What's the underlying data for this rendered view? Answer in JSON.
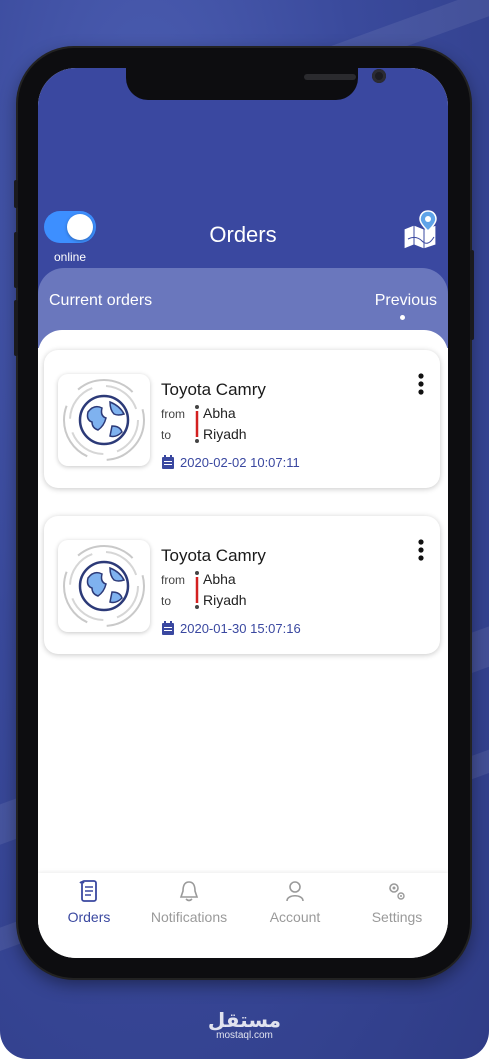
{
  "header": {
    "title": "Orders",
    "status_label": "online"
  },
  "tabs": {
    "current": "Current orders",
    "previous": "Previous"
  },
  "orders": [
    {
      "car": "Toyota Camry",
      "from_label": "from",
      "from": "Abha",
      "to_label": "to",
      "to": "Riyadh",
      "date": "2020-02-02 10:07:11"
    },
    {
      "car": "Toyota Camry",
      "from_label": "from",
      "from": "Abha",
      "to_label": "to",
      "to": "Riyadh",
      "date": "2020-01-30 15:07:16"
    }
  ],
  "bottom_nav": [
    {
      "label": "Orders",
      "icon": "orders-scroll-icon",
      "active": true
    },
    {
      "label": "Notifications",
      "icon": "bell-icon",
      "active": false
    },
    {
      "label": "Account",
      "icon": "user-icon",
      "active": false
    },
    {
      "label": "Settings",
      "icon": "gear-icon",
      "active": false
    }
  ],
  "watermark": {
    "arabic": "مستقل",
    "latin": "mostaql.com"
  },
  "colors": {
    "primary": "#3a48a0",
    "tab_bar": "#6a77bd",
    "toggle": "#3d8fff",
    "route_red": "#d32020",
    "inactive": "#9a9a9a"
  }
}
